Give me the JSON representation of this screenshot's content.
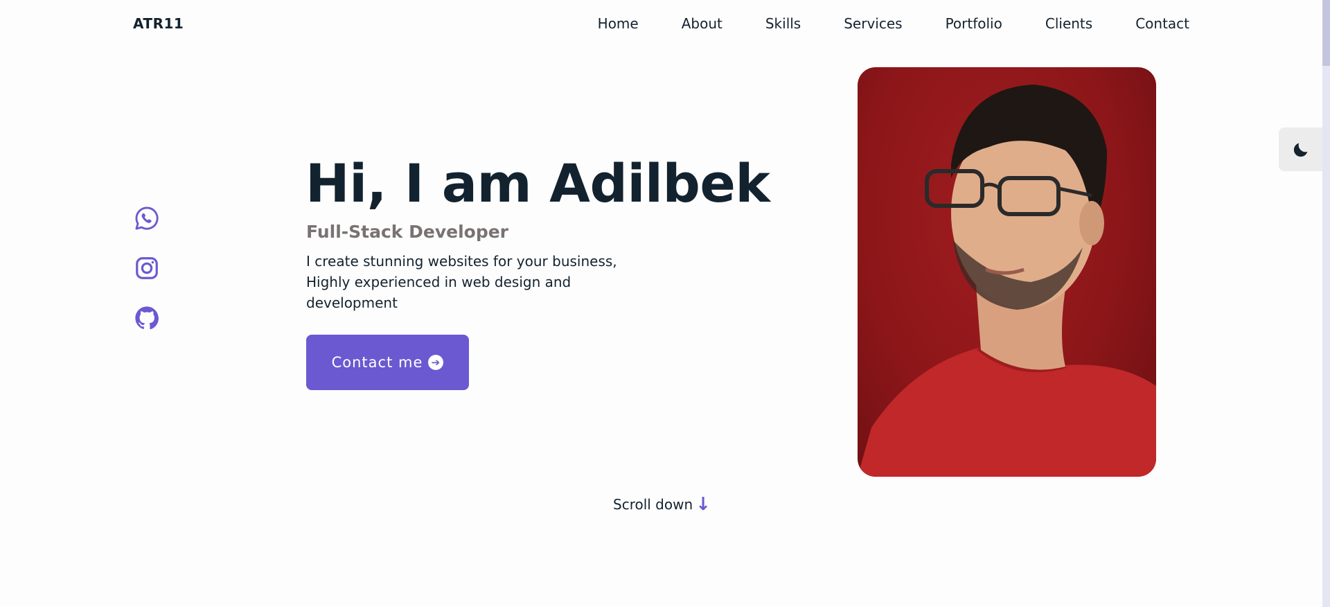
{
  "header": {
    "logo": "ATR11",
    "nav": [
      "Home",
      "About",
      "Skills",
      "Services",
      "Portfolio",
      "Clients",
      "Contact"
    ]
  },
  "social": {
    "icons": [
      "whatsapp-icon",
      "instagram-icon",
      "github-icon"
    ]
  },
  "hero": {
    "title": "Hi, I am Adilbek",
    "subtitle": "Full-Stack Developer",
    "description": "I create stunning websites for your business, Highly experienced in web design and development",
    "button_label": "Contact me",
    "button_icon": "arrow-right-circle-icon"
  },
  "scroll": {
    "label": "Scroll down",
    "icon": "arrow-down-icon"
  },
  "theme_toggle": {
    "icon": "moon-icon"
  },
  "colors": {
    "accent": "#6a59d1",
    "text": "#13222f",
    "subtitle": "#7a7272",
    "background": "#fdfdfd",
    "portrait_bg": "#8c1619"
  }
}
